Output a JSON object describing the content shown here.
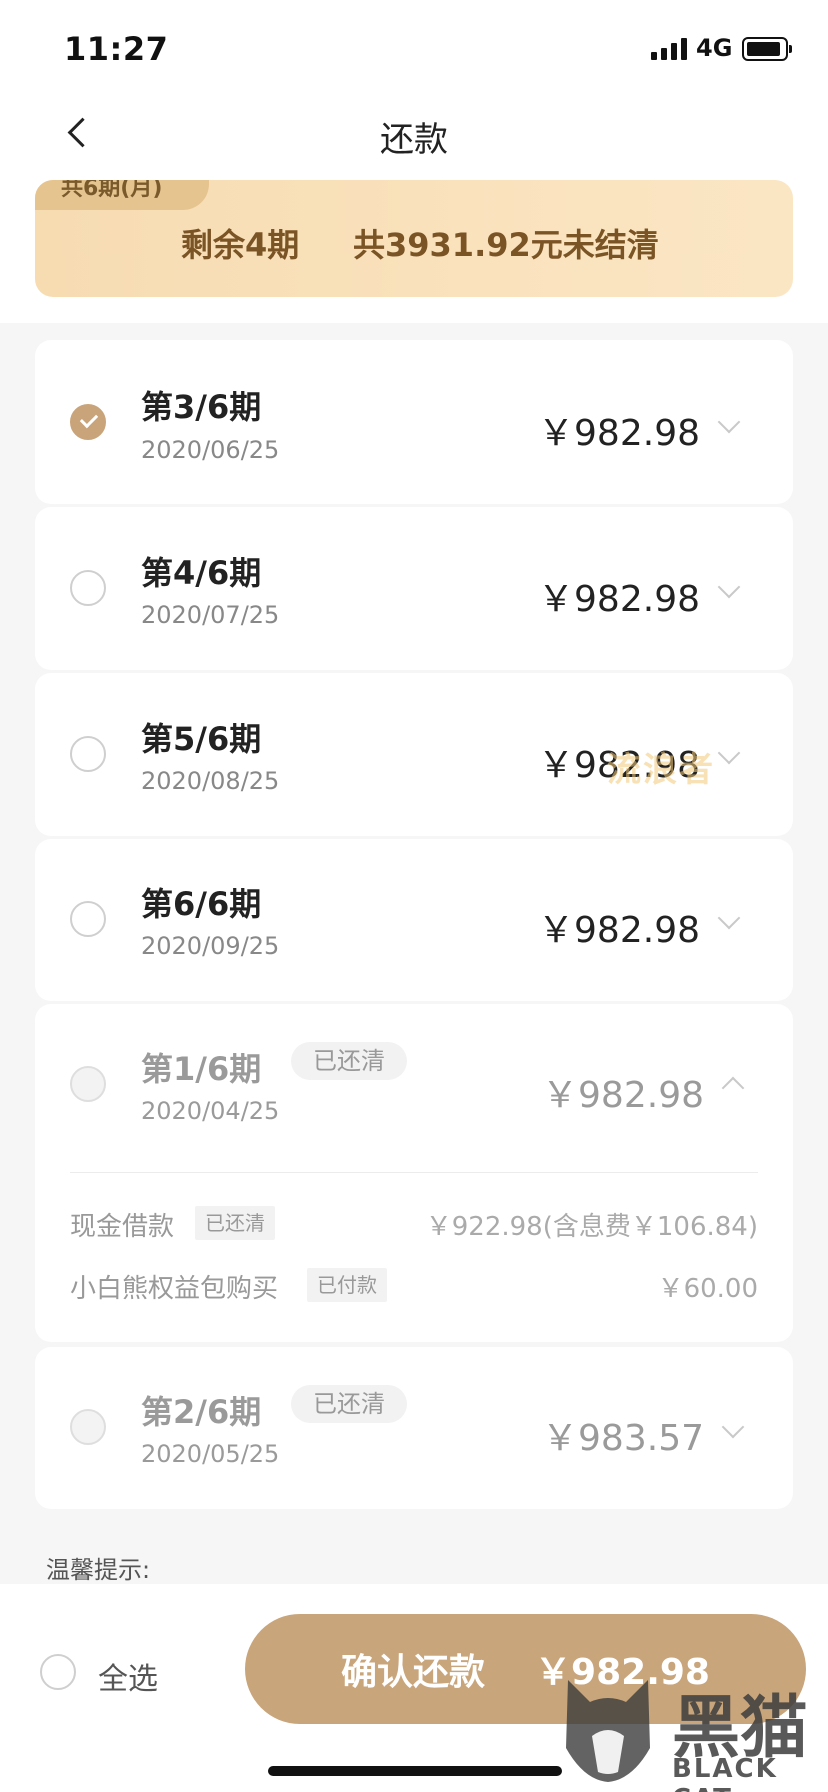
{
  "status_bar": {
    "time": "11:27",
    "network": "4G"
  },
  "nav": {
    "title": "还款"
  },
  "summary": {
    "tag": "共6期(月)",
    "remaining": "剩余4期",
    "total": "共3931.92元未结清"
  },
  "installments": [
    {
      "title": "第3/6期",
      "date": "2020/06/25",
      "amount": "￥982.98",
      "selected": true
    },
    {
      "title": "第4/6期",
      "date": "2020/07/25",
      "amount": "￥982.98",
      "selected": false
    },
    {
      "title": "第5/6期",
      "date": "2020/08/25",
      "amount": "￥982.98",
      "selected": false
    },
    {
      "title": "第6/6期",
      "date": "2020/09/25",
      "amount": "￥982.98",
      "selected": false
    }
  ],
  "paid_installments": [
    {
      "title": "第1/6期",
      "badge": "已还清",
      "date": "2020/04/25",
      "amount": "￥982.98",
      "details": [
        {
          "label": "现金借款",
          "tag": "已还清",
          "value": "￥922.98(含息费￥106.84)"
        },
        {
          "label": "小白熊权益包购买",
          "tag": "已付款",
          "value": "￥60.00"
        }
      ]
    },
    {
      "title": "第2/6期",
      "badge": "已还清",
      "date": "2020/05/25",
      "amount": "￥983.57"
    }
  ],
  "tips": {
    "label": "温馨提示:"
  },
  "bottom": {
    "select_all": "全选",
    "confirm_label": "确认还款",
    "confirm_amount": "￥982.98"
  },
  "watermark": {
    "text": "流浪者"
  },
  "logo": {
    "glyph": "黑猫",
    "text": "BLACK CAT"
  },
  "colors": {
    "accent": "#c9a57b",
    "summary_bg": "#f8dfb8",
    "summary_text": "#7b5425"
  }
}
